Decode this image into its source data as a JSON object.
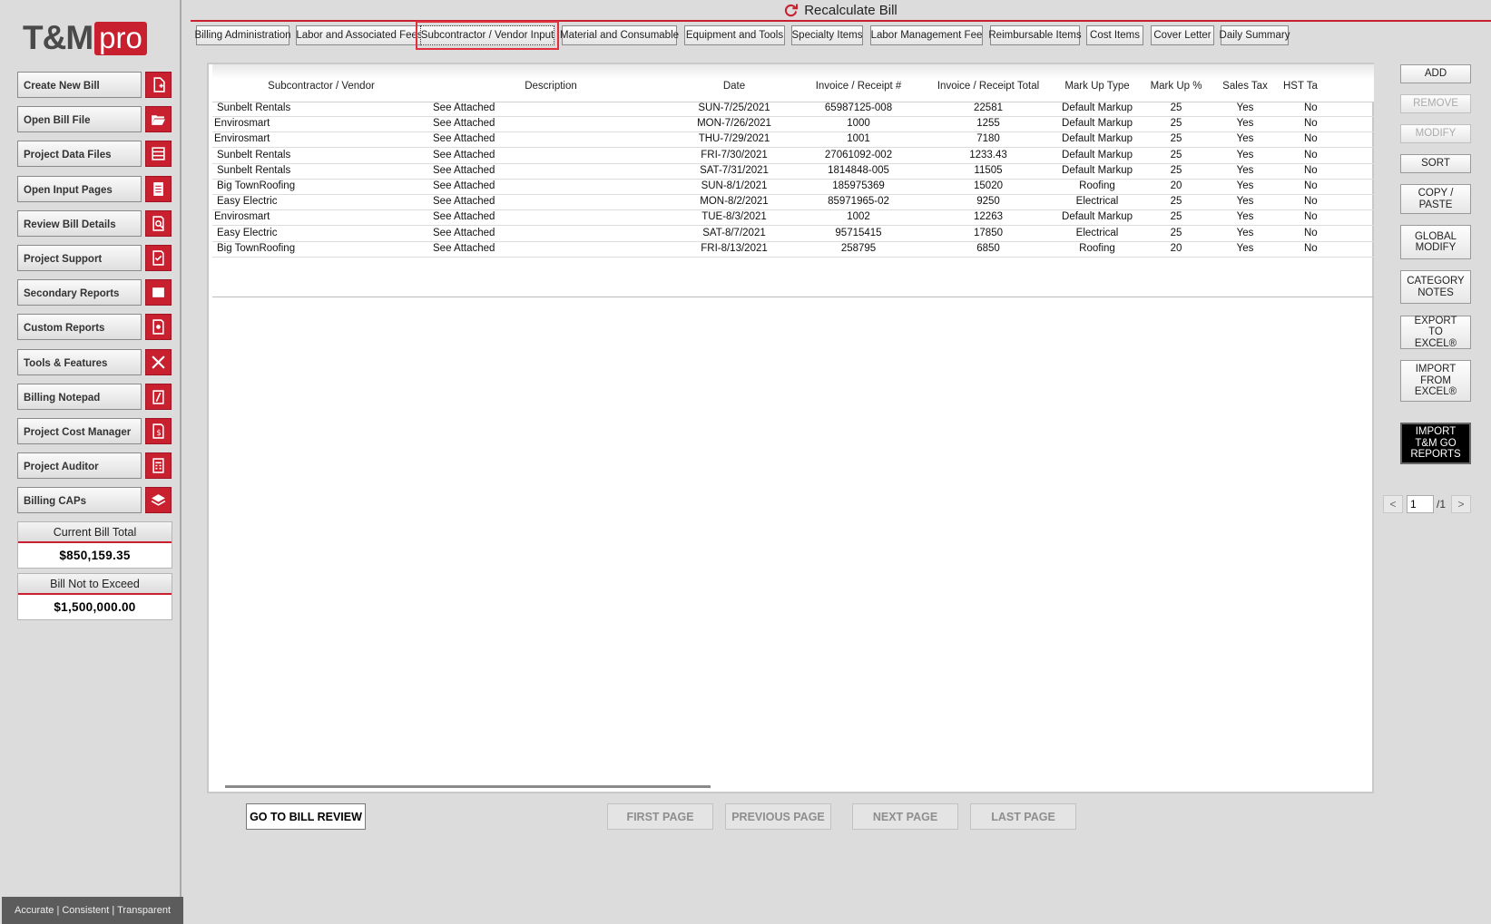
{
  "app": {
    "logo_main": "T&M",
    "logo_pro": "pro",
    "recalculate_label": "Recalculate Bill",
    "tagline": "Accurate | Consistent | Transparent"
  },
  "sidebar": {
    "items": [
      {
        "label": "Create New Bill",
        "icon": "new-file-icon"
      },
      {
        "label": "Open Bill File",
        "icon": "folder-open-icon"
      },
      {
        "label": "Project Data Files",
        "icon": "list-icon"
      },
      {
        "label": "Open Input Pages",
        "icon": "document-lines-icon"
      },
      {
        "label": "Review Bill Details",
        "icon": "magnify-document-icon"
      },
      {
        "label": "Project Support",
        "icon": "checkbox-document-icon"
      },
      {
        "label": "Secondary Reports",
        "icon": "report-icon"
      },
      {
        "label": "Custom Reports",
        "icon": "gear-document-icon"
      },
      {
        "label": "Tools & Features",
        "icon": "tools-icon"
      },
      {
        "label": "Billing Notepad",
        "icon": "notepad-icon"
      },
      {
        "label": "Project Cost Manager",
        "icon": "dollar-document-icon"
      },
      {
        "label": "Project Auditor",
        "icon": "calculator-icon"
      },
      {
        "label": "Billing CAPs",
        "icon": "layers-icon"
      }
    ],
    "current_bill_total_label": "Current Bill Total",
    "current_bill_total_value": "$850,159.35",
    "bill_not_to_exceed_label": "Bill Not to Exceed",
    "bill_not_to_exceed_value": "$1,500,000.00"
  },
  "tabs": [
    "Billing Administration",
    "Labor and Associated Fees",
    "Subcontractor / Vendor Input",
    "Material and Consumable",
    "Equipment and Tools",
    "Specialty Items",
    "Labor Management Fee",
    "Reimbursable Items",
    "Cost Items",
    "Cover Letter",
    "Daily Summary"
  ],
  "active_tab": "Subcontractor / Vendor Input",
  "table": {
    "columns": [
      "Subcontractor / Vendor",
      "Description",
      "Date",
      "Invoice / Receipt #",
      "Invoice / Receipt Total",
      "Mark Up Type",
      "Mark Up %",
      "Sales Tax",
      "HST Ta"
    ],
    "rows": [
      {
        "vendor": "Sunbelt Rentals",
        "description": "See Attached",
        "date": "SUN-7/25/2021",
        "invoice": "65987125-008",
        "total": "22581",
        "markup_type": "Default Markup",
        "markup_pct": "25",
        "sales_tax": "Yes",
        "hst": "No"
      },
      {
        "vendor": "Envirosmart",
        "description": "See Attached",
        "date": "MON-7/26/2021",
        "invoice": "1000",
        "total": "1255",
        "markup_type": "Default Markup",
        "markup_pct": "25",
        "sales_tax": "Yes",
        "hst": "No"
      },
      {
        "vendor": "Envirosmart",
        "description": "See Attached",
        "date": "THU-7/29/2021",
        "invoice": "1001",
        "total": "7180",
        "markup_type": "Default Markup",
        "markup_pct": "25",
        "sales_tax": "Yes",
        "hst": "No"
      },
      {
        "vendor": "Sunbelt Rentals",
        "description": "See Attached",
        "date": "FRI-7/30/2021",
        "invoice": "27061092-002",
        "total": "1233.43",
        "markup_type": "Default Markup",
        "markup_pct": "25",
        "sales_tax": "Yes",
        "hst": "No"
      },
      {
        "vendor": "Sunbelt Rentals",
        "description": "See Attached",
        "date": "SAT-7/31/2021",
        "invoice": "1814848-005",
        "total": "11505",
        "markup_type": "Default Markup",
        "markup_pct": "25",
        "sales_tax": "Yes",
        "hst": "No"
      },
      {
        "vendor": "Big TownRoofing",
        "description": "See Attached",
        "date": "SUN-8/1/2021",
        "invoice": "185975369",
        "total": "15020",
        "markup_type": "Roofing",
        "markup_pct": "20",
        "sales_tax": "Yes",
        "hst": "No"
      },
      {
        "vendor": "Easy Electric",
        "description": "See Attached",
        "date": "MON-8/2/2021",
        "invoice": "85971965-02",
        "total": "9250",
        "markup_type": "Electrical",
        "markup_pct": "25",
        "sales_tax": "Yes",
        "hst": "No"
      },
      {
        "vendor": "Envirosmart",
        "description": "See Attached",
        "date": "TUE-8/3/2021",
        "invoice": "1002",
        "total": "12263",
        "markup_type": "Default Markup",
        "markup_pct": "25",
        "sales_tax": "Yes",
        "hst": "No"
      },
      {
        "vendor": "Easy Electric",
        "description": "See Attached",
        "date": "SAT-8/7/2021",
        "invoice": "95715415",
        "total": "17850",
        "markup_type": "Electrical",
        "markup_pct": "25",
        "sales_tax": "Yes",
        "hst": "No"
      },
      {
        "vendor": "Big TownRoofing",
        "description": "See Attached",
        "date": "FRI-8/13/2021",
        "invoice": "258795",
        "total": "6850",
        "markup_type": "Roofing",
        "markup_pct": "20",
        "sales_tax": "Yes",
        "hst": "No"
      }
    ]
  },
  "bottom_buttons": {
    "go_to_bill_review": "GO TO BILL REVIEW",
    "first_page": "FIRST PAGE",
    "previous_page": "PREVIOUS PAGE",
    "next_page": "NEXT PAGE",
    "last_page": "LAST PAGE"
  },
  "side_buttons": {
    "add": "ADD",
    "remove": "REMOVE",
    "modify": "MODIFY",
    "sort": "SORT",
    "copy_paste": "COPY / PASTE",
    "global_modify": "GLOBAL MODIFY",
    "category_notes": "CATEGORY NOTES",
    "export_excel": "EXPORT TO EXCEL®",
    "import_excel": "IMPORT FROM EXCEL®",
    "import_tmgo": "IMPORT T&M GO REPORTS"
  },
  "pager": {
    "current": "1",
    "total": "/1",
    "prev_glyph": "<",
    "next_glyph": ">"
  },
  "colors": {
    "accent": "#c8202f",
    "sidebar_bg": "#dcdcdc"
  }
}
